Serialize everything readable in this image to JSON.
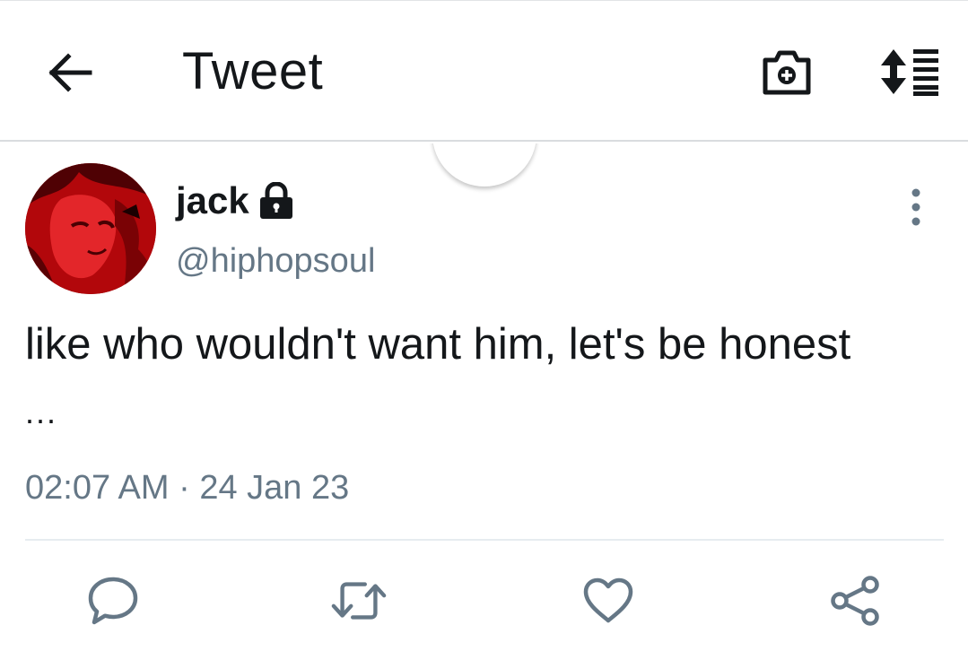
{
  "header": {
    "title": "Tweet",
    "back_icon": "arrow-left-icon",
    "camera_icon": "camera-plus-icon",
    "sort_icon": "sort-list-icon"
  },
  "tweet": {
    "author_name": "jack",
    "author_handle": "@hiphopsoul",
    "protected": true,
    "text": "like who wouldn't want him, let's be honest",
    "truncation": "...",
    "timestamp": "02:07 AM · 24 Jan 23"
  },
  "actions": [
    {
      "name": "reply",
      "icon": "reply-icon"
    },
    {
      "name": "retweet",
      "icon": "retweet-icon"
    },
    {
      "name": "like",
      "icon": "heart-icon"
    },
    {
      "name": "share",
      "icon": "share-icon"
    }
  ],
  "colors": {
    "text_primary": "#14171a",
    "text_secondary": "#657786",
    "icon_gray": "#657786",
    "avatar_accent": "#c4080d"
  }
}
